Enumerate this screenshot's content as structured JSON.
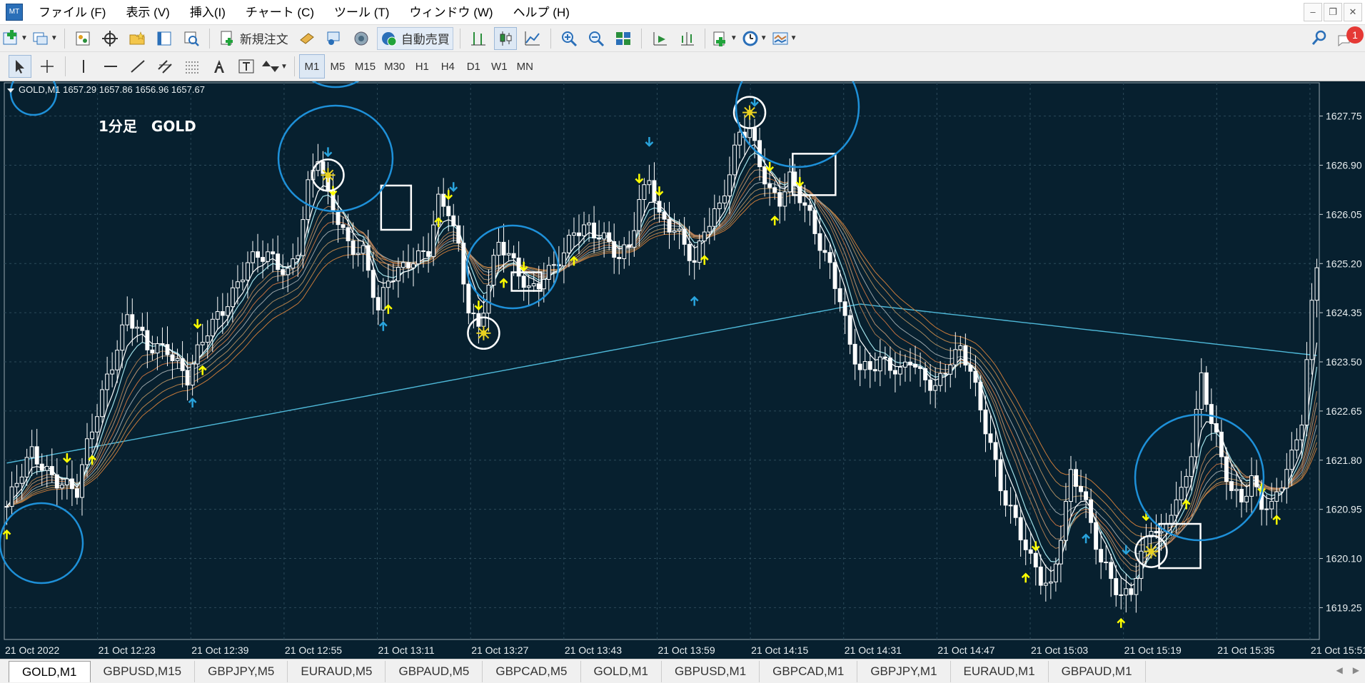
{
  "menu": [
    "ファイル (F)",
    "表示 (V)",
    "挿入(I)",
    "チャート (C)",
    "ツール (T)",
    "ウィンドウ (W)",
    "ヘルプ (H)"
  ],
  "toolbar": {
    "new_order_label": "新規注文",
    "auto_trade_label": "自動売買",
    "notification_count": "1"
  },
  "timeframes": [
    "M1",
    "M5",
    "M15",
    "M30",
    "H1",
    "H4",
    "D1",
    "W1",
    "MN"
  ],
  "active_timeframe": "M1",
  "chart": {
    "header": "GOLD,M1  1657.29 1657.86 1656.96 1657.67",
    "title_annotation": "1分足　GOLD",
    "background": "#07202f"
  },
  "chart_data": {
    "type": "candlestick",
    "symbol": "GOLD",
    "timeframe": "M1",
    "ohlc_header": [
      1657.29,
      1657.86,
      1656.96,
      1657.67
    ],
    "y_ticks": [
      1627.75,
      1626.9,
      1626.05,
      1625.2,
      1624.35,
      1623.5,
      1622.65,
      1621.8,
      1620.95,
      1620.1,
      1619.25
    ],
    "y_tick_labels": [
      "1627.75",
      "1626.90",
      "1626.05",
      "1625.20",
      "1624.35",
      "1623.50",
      "1622.65",
      "1621.80",
      "1620.95",
      "1620.10",
      "1619.25"
    ],
    "ylim": [
      1618.7,
      1628.35
    ],
    "x_tick_labels": [
      "21 Oct 2022",
      "21 Oct 12:23",
      "21 Oct 12:39",
      "21 Oct 12:55",
      "21 Oct 13:11",
      "21 Oct 13:27",
      "21 Oct 13:43",
      "21 Oct 13:59",
      "21 Oct 14:15",
      "21 Oct 14:31",
      "21 Oct 14:47",
      "21 Oct 15:03",
      "21 Oct 15:19",
      "21 Oct 15:35",
      "21 Oct 15:51"
    ],
    "close_path": [
      [
        0,
        1621.0
      ],
      [
        5,
        1621.9
      ],
      [
        10,
        1621.5
      ],
      [
        14,
        1621.2
      ],
      [
        16,
        1622.0
      ],
      [
        20,
        1623.3
      ],
      [
        24,
        1624.3
      ],
      [
        28,
        1623.7
      ],
      [
        32,
        1623.8
      ],
      [
        36,
        1623.2
      ],
      [
        40,
        1624.0
      ],
      [
        44,
        1624.6
      ],
      [
        48,
        1625.2
      ],
      [
        52,
        1625.3
      ],
      [
        56,
        1625.1
      ],
      [
        58,
        1625.5
      ],
      [
        60,
        1626.5
      ],
      [
        62,
        1627.0
      ],
      [
        64,
        1626.3
      ],
      [
        66,
        1626.0
      ],
      [
        68,
        1625.6
      ],
      [
        71,
        1625.4
      ],
      [
        74,
        1624.3
      ],
      [
        76,
        1624.9
      ],
      [
        80,
        1625.3
      ],
      [
        84,
        1625.4
      ],
      [
        86,
        1626.2
      ],
      [
        88,
        1626.1
      ],
      [
        90,
        1625.5
      ],
      [
        92,
        1624.5
      ],
      [
        94,
        1624.1
      ],
      [
        96,
        1624.8
      ],
      [
        98,
        1625.5
      ],
      [
        102,
        1625.1
      ],
      [
        104,
        1624.8
      ],
      [
        108,
        1625.0
      ],
      [
        111,
        1625.3
      ],
      [
        113,
        1625.8
      ],
      [
        116,
        1625.9
      ],
      [
        120,
        1625.5
      ],
      [
        122,
        1625.2
      ],
      [
        124,
        1625.5
      ],
      [
        126,
        1626.3
      ],
      [
        128,
        1626.8
      ],
      [
        130,
        1626.0
      ],
      [
        133,
        1625.7
      ],
      [
        135,
        1625.5
      ],
      [
        137,
        1625.2
      ],
      [
        139,
        1625.9
      ],
      [
        142,
        1626.2
      ],
      [
        144,
        1626.7
      ],
      [
        146,
        1627.4
      ],
      [
        148,
        1627.5
      ],
      [
        150,
        1627.0
      ],
      [
        152,
        1626.5
      ],
      [
        154,
        1626.3
      ],
      [
        156,
        1626.6
      ],
      [
        158,
        1626.3
      ],
      [
        160,
        1626.0
      ],
      [
        162,
        1625.6
      ],
      [
        164,
        1625.2
      ],
      [
        166,
        1624.6
      ],
      [
        168,
        1623.7
      ],
      [
        170,
        1623.3
      ],
      [
        172,
        1623.4
      ],
      [
        174,
        1623.6
      ],
      [
        176,
        1623.5
      ],
      [
        178,
        1623.3
      ],
      [
        180,
        1623.5
      ],
      [
        182,
        1623.2
      ],
      [
        185,
        1623.1
      ],
      [
        188,
        1623.6
      ],
      [
        190,
        1623.7
      ],
      [
        192,
        1623.3
      ],
      [
        194,
        1622.6
      ],
      [
        196,
        1622.1
      ],
      [
        198,
        1621.4
      ],
      [
        200,
        1621.0
      ],
      [
        202,
        1620.5
      ],
      [
        204,
        1620.0
      ],
      [
        206,
        1619.7
      ],
      [
        208,
        1619.6
      ],
      [
        210,
        1620.6
      ],
      [
        212,
        1621.6
      ],
      [
        214,
        1621.3
      ],
      [
        216,
        1620.6
      ],
      [
        218,
        1620.0
      ],
      [
        220,
        1619.8
      ],
      [
        222,
        1619.5
      ],
      [
        224,
        1619.6
      ],
      [
        226,
        1620.1
      ],
      [
        228,
        1620.6
      ],
      [
        230,
        1620.4
      ],
      [
        232,
        1621.0
      ],
      [
        234,
        1621.3
      ],
      [
        236,
        1622.0
      ],
      [
        238,
        1623.2
      ],
      [
        240,
        1622.4
      ],
      [
        242,
        1621.8
      ],
      [
        244,
        1621.3
      ],
      [
        246,
        1621.2
      ],
      [
        248,
        1621.5
      ],
      [
        250,
        1621.0
      ],
      [
        252,
        1620.9
      ],
      [
        254,
        1621.4
      ],
      [
        256,
        1621.9
      ],
      [
        258,
        1622.6
      ],
      [
        260,
        1624.5
      ],
      [
        261,
        1625.2
      ]
    ],
    "ma_lines": [
      {
        "color": "#4eb8d8",
        "role": "long"
      },
      {
        "color": "#ffffff",
        "role": "fast"
      },
      {
        "color": "#a0e0e8",
        "role": "fast"
      },
      {
        "color": "#9aa4a8",
        "role": "ribbon"
      },
      {
        "color": "#c87a3a",
        "role": "ribbon"
      },
      {
        "color": "#b8824a",
        "role": "ribbon"
      }
    ],
    "buy_arrows_x": [
      0,
      17,
      39,
      76,
      86,
      99,
      113,
      139,
      153,
      203,
      222,
      235,
      253
    ],
    "sell_arrows_x": [
      12,
      38,
      65,
      88,
      94,
      103,
      126,
      130,
      152,
      158,
      205,
      227,
      250
    ],
    "blue_up_x": [
      37,
      75,
      137,
      215
    ],
    "blue_down_x": [
      64,
      89,
      128,
      149,
      223
    ],
    "gear_markers_x": [
      64,
      95,
      148,
      228
    ],
    "grid": true
  },
  "tabs": [
    "GOLD,M1",
    "GBPUSD,M15",
    "GBPJPY,M5",
    "EURAUD,M5",
    "GBPAUD,M5",
    "GBPCAD,M5",
    "GOLD,M1",
    "GBPUSD,M1",
    "GBPCAD,M1",
    "GBPJPY,M1",
    "EURAUD,M1",
    "GBPAUD,M1"
  ],
  "active_tab_index": 0,
  "colors": {
    "buy_arrow": "#ffff00",
    "sell_arrow": "#ffff00",
    "blue_arrow": "#29a3dc",
    "annotation_circle": "#1e90d8",
    "candle": "#ffffff"
  }
}
